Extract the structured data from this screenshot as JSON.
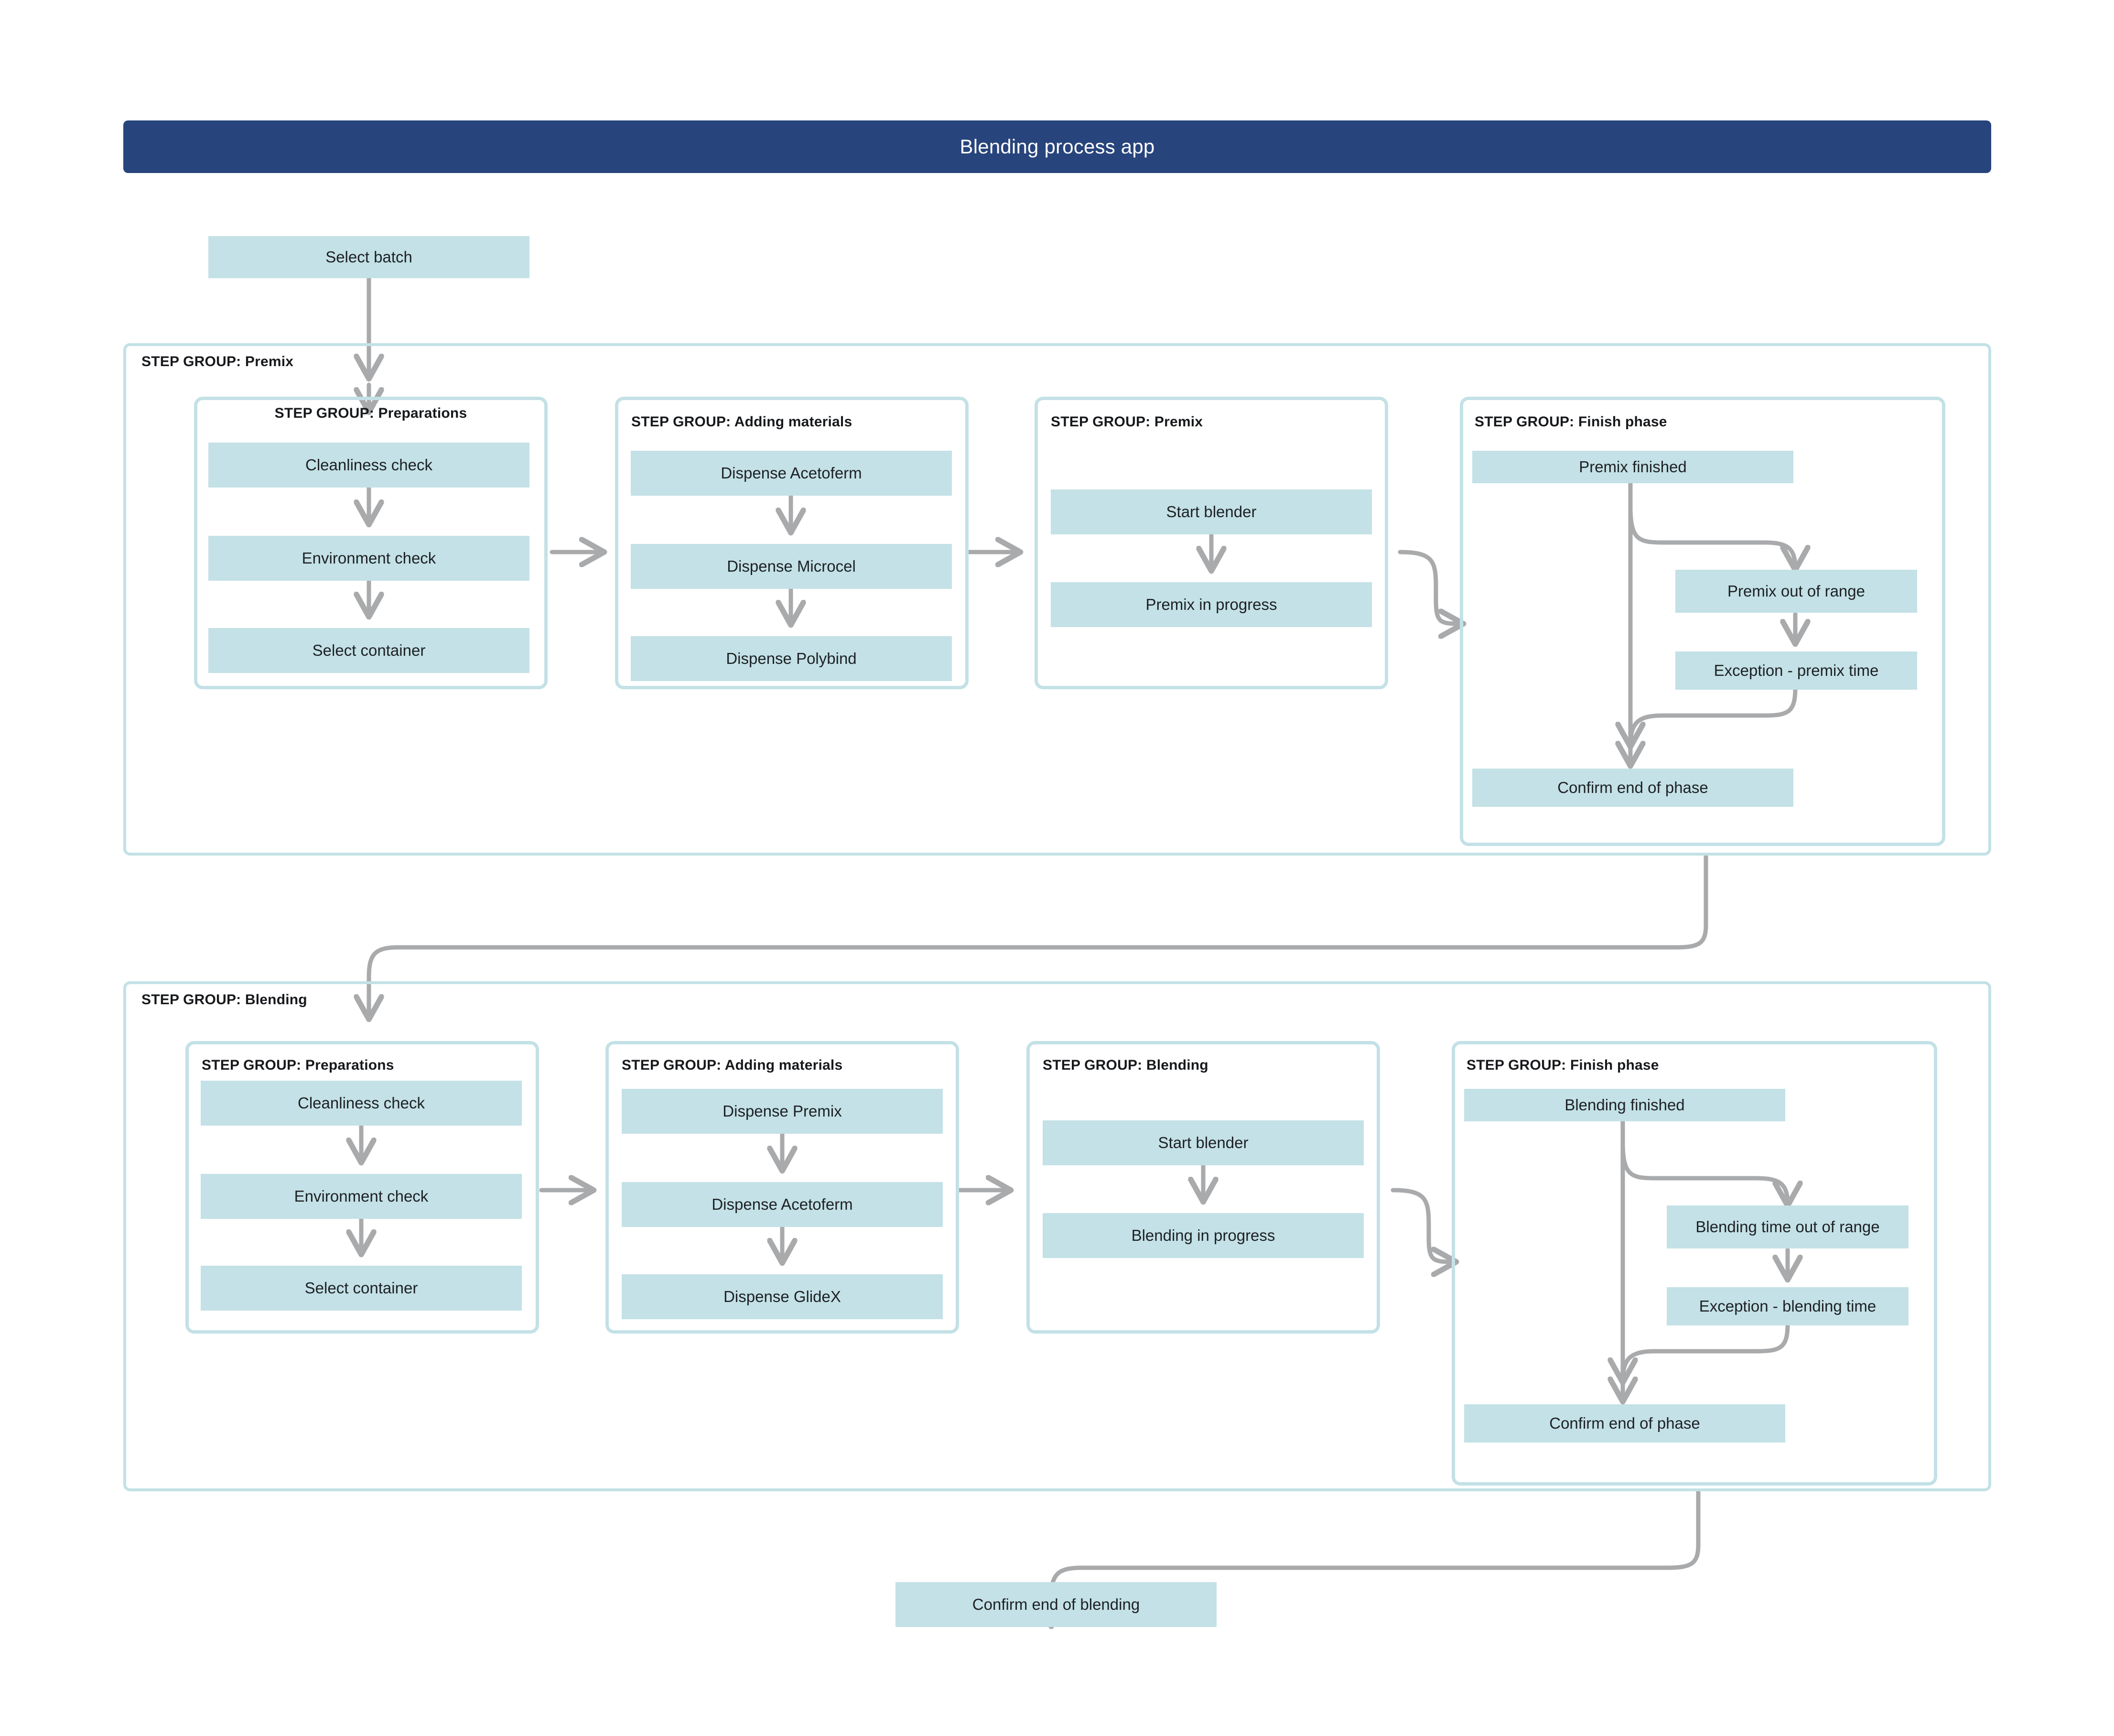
{
  "header": {
    "title": "Blending process app"
  },
  "colors": {
    "header_bar": "#27447c",
    "step_fill": "#c3e1e6",
    "group_border": "#c3e1e6",
    "connector": "#a9aaac",
    "text": "#1d2024"
  },
  "start_step": {
    "label": "Select batch"
  },
  "end_step": {
    "label": "Confirm end of blending"
  },
  "sections": [
    {
      "title": "STEP GROUP: Premix",
      "groups": [
        {
          "title": "STEP GROUP: Preparations",
          "steps": [
            "Cleanliness check",
            "Environment check",
            "Select container"
          ]
        },
        {
          "title": "STEP GROUP: Adding materials",
          "steps": [
            "Dispense Acetoferm",
            "Dispense Microcel",
            "Dispense Polybind"
          ]
        },
        {
          "title": "STEP GROUP: Premix",
          "steps": [
            "Start blender",
            "Premix in progress"
          ]
        },
        {
          "title": "STEP GROUP: Finish phase",
          "steps": [
            "Premix finished",
            "Premix out of range",
            "Exception - premix time",
            "Confirm end of phase"
          ]
        }
      ]
    },
    {
      "title": "STEP GROUP: Blending",
      "groups": [
        {
          "title": "STEP GROUP: Preparations",
          "steps": [
            "Cleanliness check",
            "Environment check",
            "Select container"
          ]
        },
        {
          "title": "STEP GROUP: Adding materials",
          "steps": [
            "Dispense Premix",
            "Dispense Acetoferm",
            "Dispense GlideX"
          ]
        },
        {
          "title": "STEP GROUP: Blending",
          "steps": [
            "Start blender",
            "Blending in progress"
          ]
        },
        {
          "title": "STEP GROUP: Finish phase",
          "steps": [
            "Blending finished",
            "Blending time out of range",
            "Exception - blending time",
            "Confirm end of phase"
          ]
        }
      ]
    }
  ]
}
